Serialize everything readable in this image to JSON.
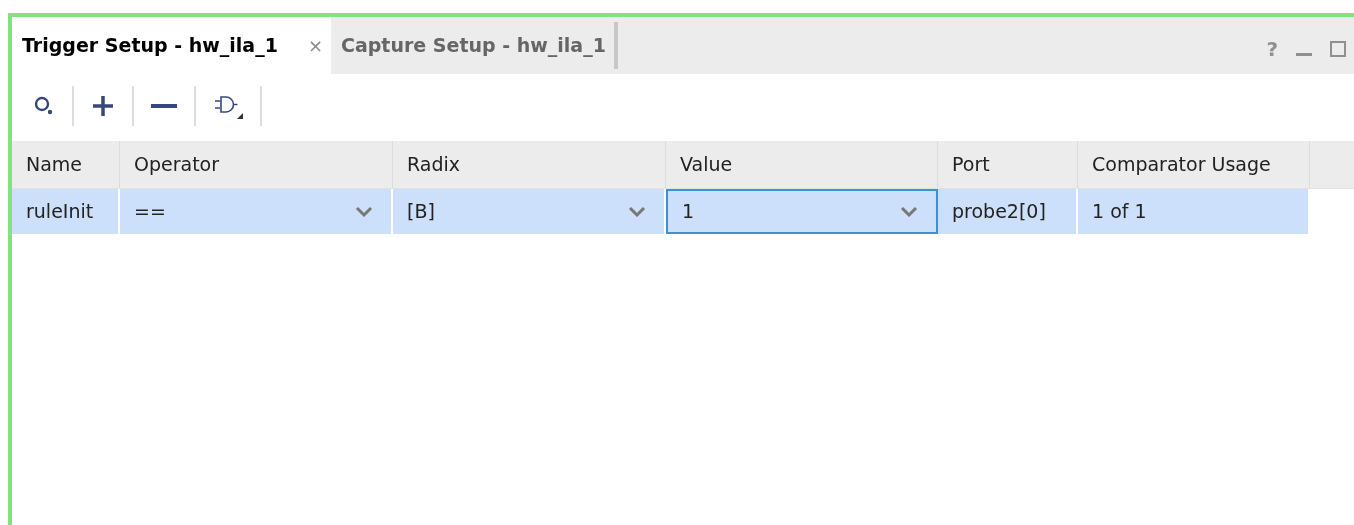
{
  "tabs": [
    {
      "label": "Trigger Setup - hw_ila_1",
      "selected": true,
      "close": "×"
    },
    {
      "label": "Capture Setup - hw_ila_1",
      "selected": false
    }
  ],
  "window_controls": [
    {
      "kind": "help",
      "label": "?"
    },
    {
      "kind": "minimize"
    },
    {
      "kind": "maximize"
    }
  ],
  "toolbar": [
    {
      "kind": "search"
    },
    {
      "kind": "add"
    },
    {
      "kind": "remove"
    },
    {
      "kind": "gate"
    }
  ],
  "table": {
    "columns": [
      "Name",
      "Operator",
      "Radix",
      "Value",
      "Port",
      "Comparator Usage"
    ],
    "rows": [
      {
        "selected": true,
        "cells": [
          {
            "kind": "text",
            "text": "ruleInit"
          },
          {
            "kind": "dropdown",
            "text": "==",
            "focused": false
          },
          {
            "kind": "dropdown",
            "text": "[B]",
            "focused": false
          },
          {
            "kind": "dropdown",
            "text": "1",
            "focused": true
          },
          {
            "kind": "text",
            "text": "probe2[0]"
          },
          {
            "kind": "text",
            "text": "1 of 1"
          }
        ]
      }
    ]
  }
}
